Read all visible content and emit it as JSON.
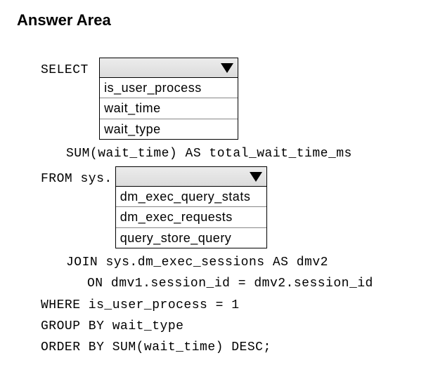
{
  "title": "Answer Area",
  "sql": {
    "select_kw": "SELECT ",
    "dropdown1": {
      "options": [
        "is_user_process",
        "wait_time",
        "wait_type"
      ]
    },
    "sum_line": "SUM(wait_time) AS total_wait_time_ms",
    "from_kw": "FROM sys.",
    "dropdown2": {
      "options": [
        "dm_exec_query_stats",
        "dm_exec_requests",
        "query_store_query"
      ]
    },
    "join_line": "JOIN sys.dm_exec_sessions AS dmv2",
    "on_line": "ON dmv1.session_id = dmv2.session_id",
    "where_line": "WHERE is_user_process = 1",
    "group_line": "GROUP BY wait_type",
    "order_line": "ORDER BY SUM(wait_time) DESC;"
  }
}
